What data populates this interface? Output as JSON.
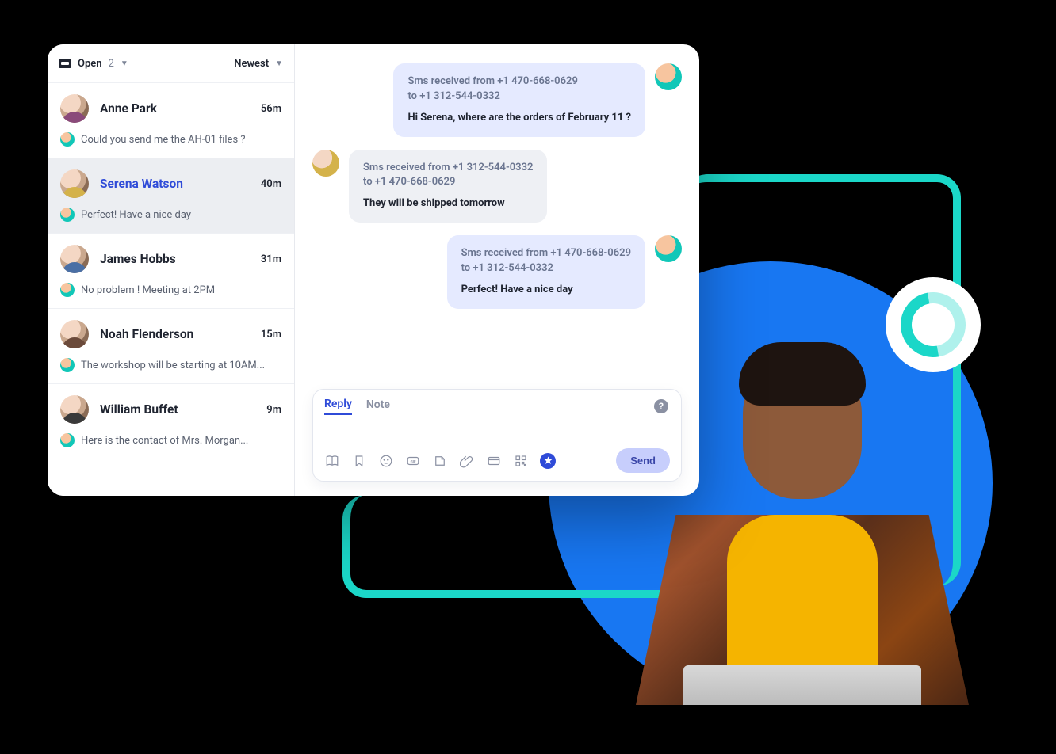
{
  "sidebar": {
    "filter_label": "Open",
    "filter_count": "2",
    "sort_label": "Newest",
    "conversations": [
      {
        "name": "Anne Park",
        "time": "56m",
        "preview": "Could you send me the AH-01 files ?"
      },
      {
        "name": "Serena Watson",
        "time": "40m",
        "preview": "Perfect! Have a nice day"
      },
      {
        "name": "James Hobbs",
        "time": "31m",
        "preview": "No problem ! Meeting at 2PM"
      },
      {
        "name": "Noah Flenderson",
        "time": "15m",
        "preview": "The workshop will be starting at 10AM..."
      },
      {
        "name": "William Buffet",
        "time": "9m",
        "preview": "Here is the contact of Mrs. Morgan..."
      }
    ],
    "selected_index": 1
  },
  "chat": {
    "messages": [
      {
        "side": "right",
        "meta_line1": "Sms received from +1 470-668-0629",
        "meta_line2": "to +1 312-544-0332",
        "text": "Hi Serena, where are the orders of February 11 ?"
      },
      {
        "side": "left",
        "meta_line1": "Sms received from +1 312-544-0332",
        "meta_line2": "to +1 470-668-0629",
        "text": "They will be shipped tomorrow"
      },
      {
        "side": "right",
        "meta_line1": "Sms received from +1 470-668-0629",
        "meta_line2": "to +1 312-544-0332",
        "text": "Perfect! Have a nice day"
      }
    ]
  },
  "composer": {
    "tab_reply": "Reply",
    "tab_note": "Note",
    "send_label": "Send",
    "help_glyph": "?"
  },
  "icons": {
    "tools": [
      "book-icon",
      "bookmark-icon",
      "emoji-icon",
      "gif-icon",
      "sticker-icon",
      "attachment-icon",
      "card-icon",
      "qr-icon",
      "star-icon"
    ]
  }
}
